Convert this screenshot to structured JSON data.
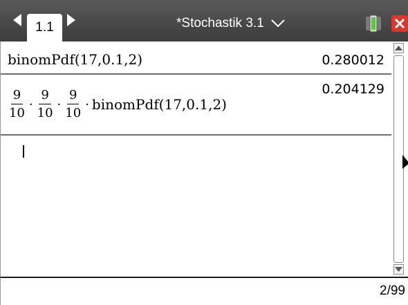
{
  "titlebar": {
    "page_tab_label": "1.1",
    "document_title": "*Stochastik 3.1"
  },
  "history": {
    "entries": [
      {
        "expression": "binomPdf(17,0.1,2)",
        "result": "0.280012"
      },
      {
        "fractions": [
          {
            "numerator": "9",
            "denominator": "10"
          },
          {
            "numerator": "9",
            "denominator": "10"
          },
          {
            "numerator": "9",
            "denominator": "10"
          }
        ],
        "multiply_dot": "·",
        "function_call": "binomPdf(17,0.1,2)",
        "result": "0.204129"
      }
    ],
    "input_value": ""
  },
  "status": {
    "entry_counter": "2/99"
  },
  "colors": {
    "titlebar_bg": "#4a4a4a",
    "tab_bg": "#ffffff",
    "close_red": "#d63a2f",
    "battery_green": "#5cc83b"
  },
  "icons": {
    "nav_left": "triangle-left-icon",
    "nav_right": "triangle-right-icon",
    "dropdown": "chevron-down-icon",
    "battery": "battery-icon",
    "close": "close-icon",
    "scroll_up": "scroll-up-arrow-icon",
    "scroll_down": "scroll-down-arrow-icon"
  }
}
